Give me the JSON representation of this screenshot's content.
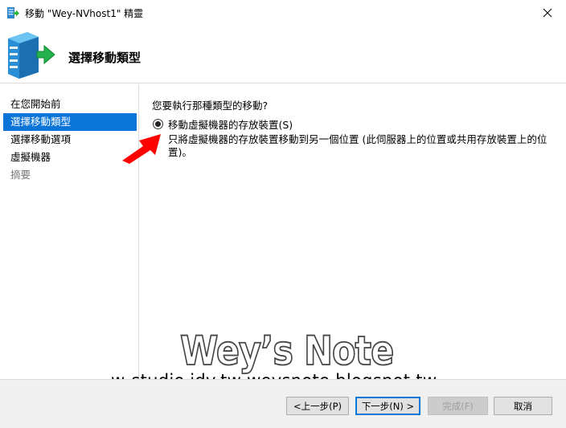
{
  "window": {
    "title": "移動 \"Wey-NVhost1\" 精靈",
    "icon": "migrate-icon",
    "close_icon": "close-icon"
  },
  "header": {
    "title": "選擇移動類型",
    "icon": "server-migrate-icon"
  },
  "sidebar": {
    "items": [
      {
        "label": "在您開始前",
        "state": "normal"
      },
      {
        "label": "選擇移動類型",
        "state": "active"
      },
      {
        "label": "選擇移動選項",
        "state": "normal"
      },
      {
        "label": "虛擬機器",
        "state": "normal"
      },
      {
        "label": "摘要",
        "state": "disabled"
      }
    ]
  },
  "main": {
    "question": "您要執行那種類型的移動?",
    "option": {
      "label": "移動虛擬機器的存放裝置(S)",
      "selected": true,
      "description": "只將虛擬機器的存放裝置移動到另一個位置 (此伺服器上的位置或共用存放裝置上的位置)。"
    }
  },
  "watermark": {
    "title": "Wey’s Note",
    "url": "w-studio.idv.tw  weysnote.blogspot.tw"
  },
  "footer": {
    "prev_label": "<上一步(P)",
    "next_label": "下一步(N) >",
    "finish_label": "完成(F)",
    "cancel_label": "取消"
  },
  "colors": {
    "accent": "#0a74d8",
    "arrow": "#ff0000",
    "footer_bg": "#f0f0f0"
  }
}
